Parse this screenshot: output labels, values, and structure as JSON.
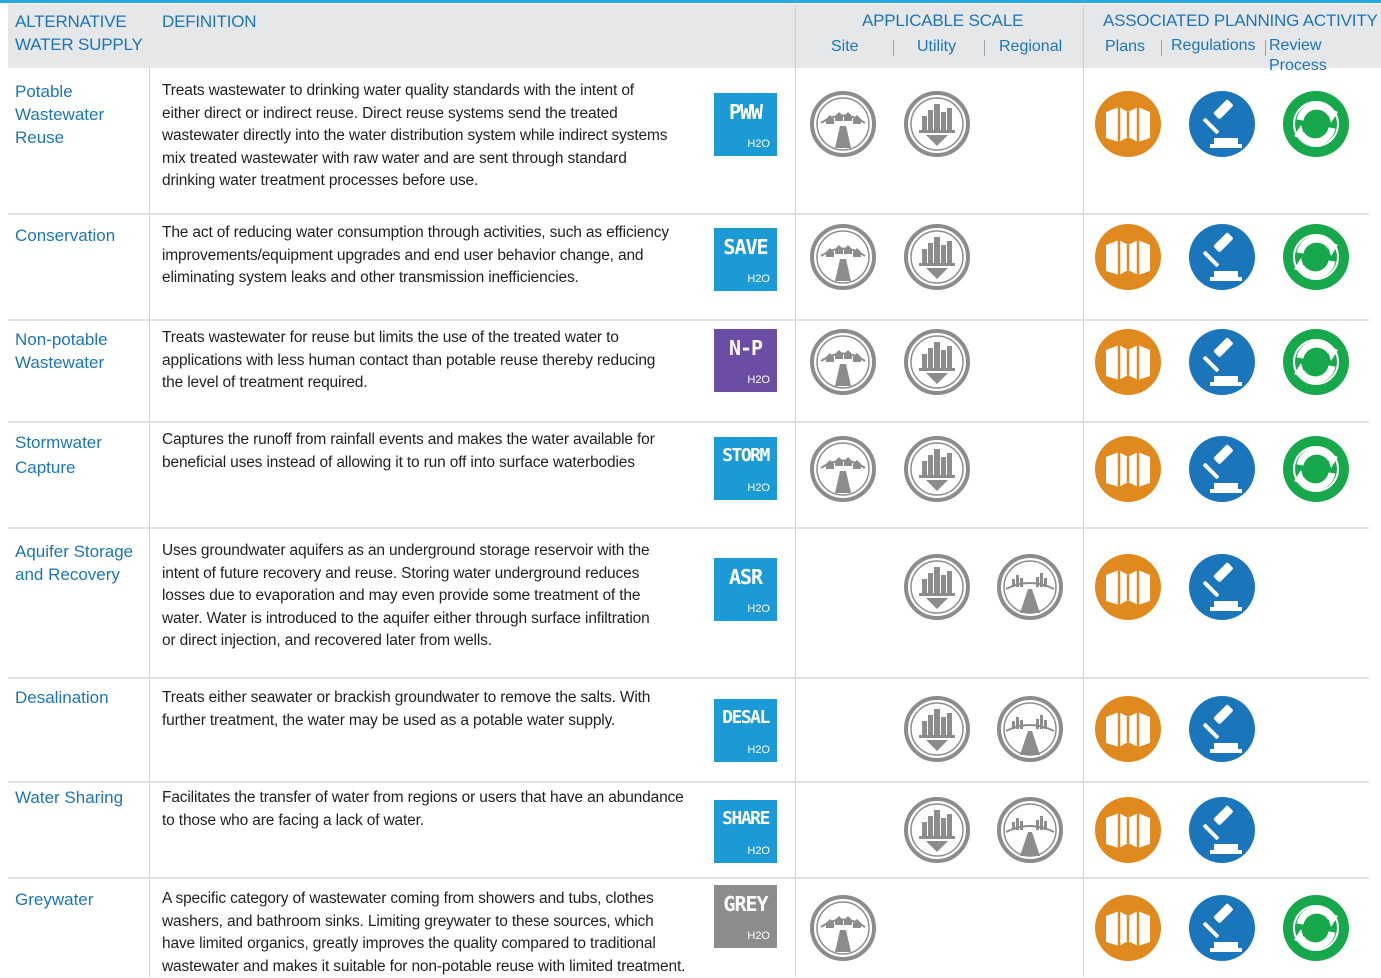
{
  "header": {
    "col_alt_line1": "ALTERNATIVE",
    "col_alt_line2": "WATER SUPPLY",
    "col_def": "DEFINITION",
    "col_scale": "APPLICABLE SCALE",
    "col_planning": "ASSOCIATED PLANNING ACTIVITY",
    "scale_site": "Site",
    "scale_utility": "Utility",
    "scale_regional": "Regional",
    "plan_plans": "Plans",
    "plan_regulations": "Regulations",
    "plan_review": "Review Process"
  },
  "colors": {
    "header_blue": "#1b75bb",
    "badge_blue": "#1b9ad6",
    "badge_purple": "#6b4ea3",
    "badge_grey": "#8a8c8e",
    "plans_orange": "#e0891f",
    "regulations_blue": "#1b75bb",
    "review_green": "#17a84c",
    "scale_grey": "#8a8c8e"
  },
  "icons": {
    "site": "site-neighborhood-icon",
    "utility": "utility-city-arrow-icon",
    "regional": "regional-skyline-icon",
    "plans": "map-icon",
    "regulations": "gavel-icon",
    "review": "recycle-arrows-icon"
  },
  "rows": [
    {
      "name_lines": [
        "Potable",
        "Wastewater",
        "Reuse"
      ],
      "definition_lines": [
        "Treats wastewater to drinking water quality standards with the intent of",
        "either direct or indirect reuse. Direct reuse systems send the treated",
        "wastewater directly into the water distribution system while indirect systems",
        "mix treated wastewater with raw water and are sent through standard",
        "drinking water treatment processes before use."
      ],
      "badge": "PWW",
      "badge_sub": "H2O",
      "badge_color": "#1b9ad6",
      "site": true,
      "utility": true,
      "regional": false,
      "plans": true,
      "regulations": true,
      "review": true
    },
    {
      "name_lines": [
        "Conservation"
      ],
      "definition_lines": [
        "The act of reducing water consumption through activities, such as efficiency",
        "improvements/equipment upgrades and end user behavior change, and",
        "eliminating system leaks and other transmission inefficiencies."
      ],
      "badge": "SAVE",
      "badge_sub": "H2O",
      "badge_color": "#1b9ad6",
      "site": true,
      "utility": true,
      "regional": false,
      "plans": true,
      "regulations": true,
      "review": true
    },
    {
      "name_lines": [
        "Non-potable",
        "Wastewater"
      ],
      "definition_lines": [
        "Treats wastewater for reuse but limits the use of the treated water to",
        "applications with less human contact than potable reuse thereby reducing",
        "the level of treatment required."
      ],
      "badge": "N-P",
      "badge_sub": "H2O",
      "badge_color": "#6b4ea3",
      "site": true,
      "utility": true,
      "regional": false,
      "plans": true,
      "regulations": true,
      "review": true
    },
    {
      "name_lines": [
        "Stormwater",
        "Capture"
      ],
      "definition_lines": [
        "Captures the runoff from rainfall events and makes the water available for",
        "beneficial uses instead of allowing it to run off into surface waterbodies"
      ],
      "badge": "STORM",
      "badge_sub": "H2O",
      "badge_color": "#1b9ad6",
      "site": true,
      "utility": true,
      "regional": false,
      "plans": true,
      "regulations": true,
      "review": true
    },
    {
      "name_lines": [
        "Aquifer Storage",
        "and Recovery"
      ],
      "definition_lines": [
        "Uses groundwater aquifers as an underground storage reservoir with the",
        "intent of future recovery and reuse. Storing water underground reduces",
        "losses due to evaporation and may even provide some treatment of the",
        "water. Water is introduced to the aquifer either through surface infiltration",
        "or direct injection, and recovered later from wells."
      ],
      "badge": "ASR",
      "badge_sub": "H2O",
      "badge_color": "#1b9ad6",
      "site": false,
      "utility": true,
      "regional": true,
      "plans": true,
      "regulations": true,
      "review": false
    },
    {
      "name_lines": [
        "Desalination"
      ],
      "definition_lines": [
        "Treats either seawater or brackish groundwater to remove the salts. With",
        "further treatment, the water may be used as a potable water supply."
      ],
      "badge": "DESAL",
      "badge_sub": "H2O",
      "badge_color": "#1b9ad6",
      "site": false,
      "utility": true,
      "regional": true,
      "plans": true,
      "regulations": true,
      "review": false
    },
    {
      "name_lines": [
        "Water Sharing"
      ],
      "definition_lines": [
        "Facilitates the transfer of water from regions or users that have an abundance",
        "to those who are facing a lack of water."
      ],
      "badge": "SHARE",
      "badge_sub": "H2O",
      "badge_color": "#1b9ad6",
      "site": false,
      "utility": true,
      "regional": true,
      "plans": true,
      "regulations": true,
      "review": false
    },
    {
      "name_lines": [
        "Greywater"
      ],
      "definition_lines": [
        "A specific category of wastewater coming from showers and tubs, clothes",
        "washers, and bathroom sinks. Limiting greywater to these sources, which",
        "have limited organics, greatly improves the quality compared to traditional",
        "wastewater and makes it suitable for non-potable reuse with limited treatment."
      ],
      "badge": "GREY",
      "badge_sub": "H2O",
      "badge_color": "#8a8c8e",
      "site": true,
      "utility": false,
      "regional": false,
      "plans": true,
      "regulations": true,
      "review": true
    }
  ]
}
